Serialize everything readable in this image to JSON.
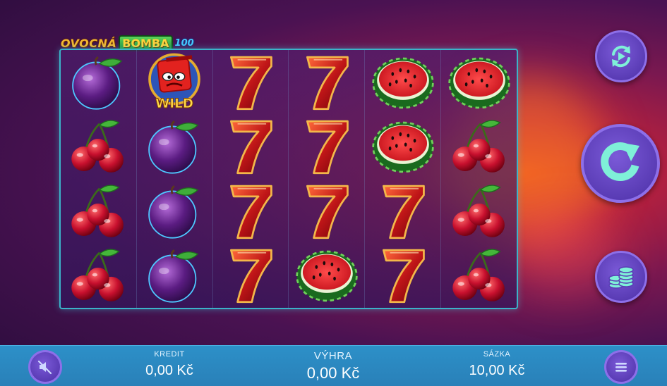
{
  "game": {
    "logo_part1": "OVOCNÁ",
    "logo_part2": "BOMBA",
    "logo_part3": "100",
    "wild_label": "WILD"
  },
  "reels": [
    [
      "plum",
      "cherry",
      "cherry",
      "cherry"
    ],
    [
      "wild",
      "plum",
      "plum",
      "plum"
    ],
    [
      "seven",
      "seven",
      "seven",
      "seven"
    ],
    [
      "seven",
      "seven",
      "seven",
      "watermelon"
    ],
    [
      "watermelon",
      "watermelon",
      "seven",
      "seven"
    ],
    [
      "watermelon",
      "cherry",
      "cherry",
      "cherry"
    ]
  ],
  "controls": {
    "autoplay_icon": "autoplay-icon",
    "spin_icon": "spin-arrow-icon",
    "bet_icon": "coins-stack-icon",
    "sound_icon": "sound-off-icon",
    "menu_icon": "hamburger-menu-icon"
  },
  "status": {
    "credit_label": "KREDIT",
    "credit_value": "0,00 Kč",
    "win_label": "VÝHRA",
    "win_value": "0,00 Kč",
    "bet_label": "SÁZKA",
    "bet_value": "10,00 Kč"
  },
  "colors": {
    "bottom_bar": "#2a8cc4",
    "button_fill": "#5a3cb5",
    "spin_arrow": "#7ff0d8",
    "reel_border": "#3bb3c9"
  }
}
